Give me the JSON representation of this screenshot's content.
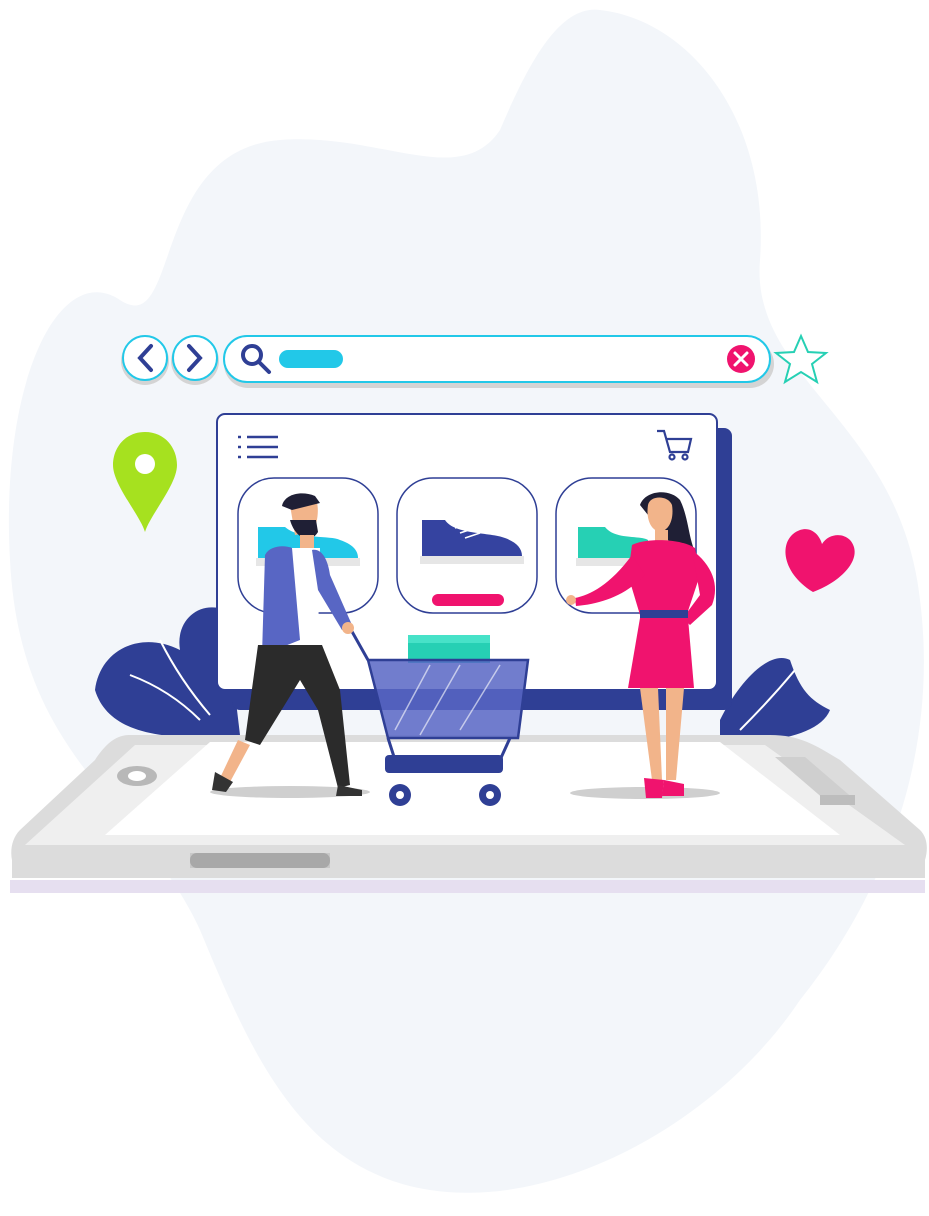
{
  "scene": {
    "colors": {
      "blob": "#f3f6fa",
      "navy": "#2f3f95",
      "royal": "#4351a8",
      "cyan": "#22c8e8",
      "teal": "#26d0b4",
      "pink": "#f0136e",
      "lime": "#a6e11f",
      "device_gray": "#d7d7d7",
      "device_light": "#eeeeee"
    }
  },
  "browser_bar": {
    "back_icon": "chevron-left",
    "forward_icon": "chevron-right",
    "search_icon": "magnifier",
    "clear_icon": "close-x",
    "favorite_icon": "star-outline"
  },
  "shop_window": {
    "menu_icon": "list-lines",
    "cart_icon": "shopping-cart",
    "products": [
      {
        "shoe_color": "#22c8e8"
      },
      {
        "shoe_color": "#3543a0",
        "selected": true
      },
      {
        "shoe_color": "#26d0b4"
      }
    ]
  },
  "decor": {
    "location_pin": "map-pin",
    "heart": "heart"
  }
}
